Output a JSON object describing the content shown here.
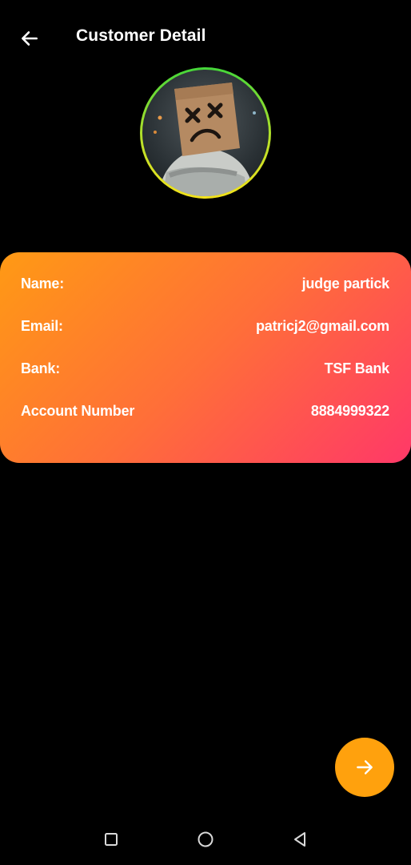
{
  "app_bar": {
    "title": "Customer Detail",
    "back_icon": "arrow-left-icon"
  },
  "avatar": {
    "description_icon": "profile-photo",
    "ring_colors": [
      "#44d63a",
      "#f3e21c"
    ]
  },
  "card": {
    "gradient": [
      "#ff9a14",
      "#ff3868"
    ],
    "rows": [
      {
        "label": "Name:",
        "value": "judge partick"
      },
      {
        "label": "Email:",
        "value": "patricj2@gmail.com"
      },
      {
        "label": "Bank:",
        "value": "TSF Bank"
      },
      {
        "label": "Account Number",
        "value": "8884999322"
      }
    ]
  },
  "fab": {
    "icon": "arrow-right-icon",
    "color": "#ffa10d"
  },
  "nav": {
    "recents_icon": "square-icon",
    "home_icon": "circle-icon",
    "back_icon": "triangle-back-icon"
  }
}
